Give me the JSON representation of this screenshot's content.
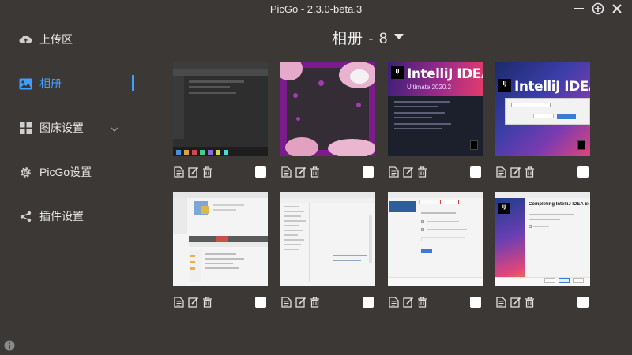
{
  "window": {
    "title": "PicGo - 2.3.0-beta.3",
    "controls": [
      "minimize-icon",
      "add-icon",
      "close-icon"
    ]
  },
  "sidebar": {
    "items": [
      {
        "label": "上传区",
        "icon": "cloud-upload-icon"
      },
      {
        "label": "相册",
        "icon": "image-icon",
        "active": true
      },
      {
        "label": "图床设置",
        "icon": "grid-icon",
        "expandable": true
      },
      {
        "label": "PicGo设置",
        "icon": "gear-icon"
      },
      {
        "label": "插件设置",
        "icon": "share-icon"
      }
    ]
  },
  "gallery": {
    "title": "相册 - 8",
    "thumbnails": [
      {
        "text": ""
      },
      {
        "text": ""
      },
      {
        "text": "IntelliJ IDEA",
        "subtext": "Ultimate 2020.2",
        "badge": "IJ"
      },
      {
        "text": "IntelliJ IDEA",
        "badge": "IJ"
      },
      {
        "text": ""
      },
      {
        "text": ""
      },
      {
        "text": ""
      },
      {
        "text": "Completing IntelliJ IDEA Setup",
        "badge": "IJ"
      }
    ]
  },
  "colors": {
    "background": "#3b3835",
    "accent": "#409eff",
    "text": "#e6e6e6"
  }
}
